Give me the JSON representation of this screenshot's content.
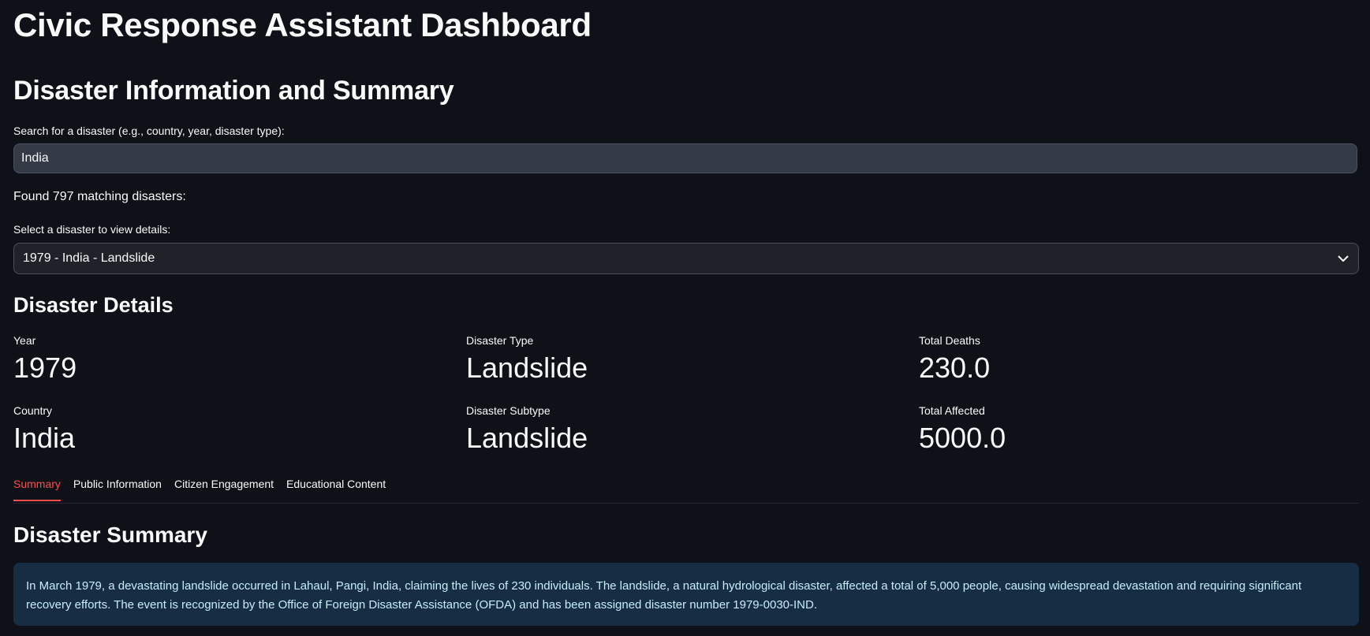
{
  "app": {
    "title": "Civic Response Assistant Dashboard"
  },
  "section": {
    "title": "Disaster Information and Summary"
  },
  "search": {
    "label": "Search for a disaster (e.g., country, year, disaster type):",
    "value": "India",
    "result_text": "Found 797 matching disasters:"
  },
  "selector": {
    "label": "Select a disaster to view details:",
    "selected": "1979 - India - Landslide"
  },
  "details": {
    "title": "Disaster Details",
    "metrics": [
      {
        "label": "Year",
        "value": "1979"
      },
      {
        "label": "Disaster Type",
        "value": "Landslide"
      },
      {
        "label": "Total Deaths",
        "value": "230.0"
      },
      {
        "label": "Country",
        "value": "India"
      },
      {
        "label": "Disaster Subtype",
        "value": "Landslide"
      },
      {
        "label": "Total Affected",
        "value": "5000.0"
      }
    ]
  },
  "tabs": [
    {
      "label": "Summary",
      "active": true
    },
    {
      "label": "Public Information",
      "active": false
    },
    {
      "label": "Citizen Engagement",
      "active": false
    },
    {
      "label": "Educational Content",
      "active": false
    }
  ],
  "summary": {
    "title": "Disaster Summary",
    "text": "In March 1979, a devastating landslide occurred in Lahaul, Pangi, India, claiming the lives of 230 individuals. The landslide, a natural hydrological disaster, affected a total of 5,000 people, causing widespread devastation and requiring significant recovery efforts. The event is recognized by the Office of Foreign Disaster Assistance (OFDA) and has been assigned disaster number 1979-0030-IND."
  },
  "colors": {
    "background": "#0e1117",
    "accent": "#ff4b4b",
    "info_bg": "#172d43",
    "info_text": "#c7ebff"
  },
  "icons": {
    "select_chevron": "chevron-down-icon"
  }
}
